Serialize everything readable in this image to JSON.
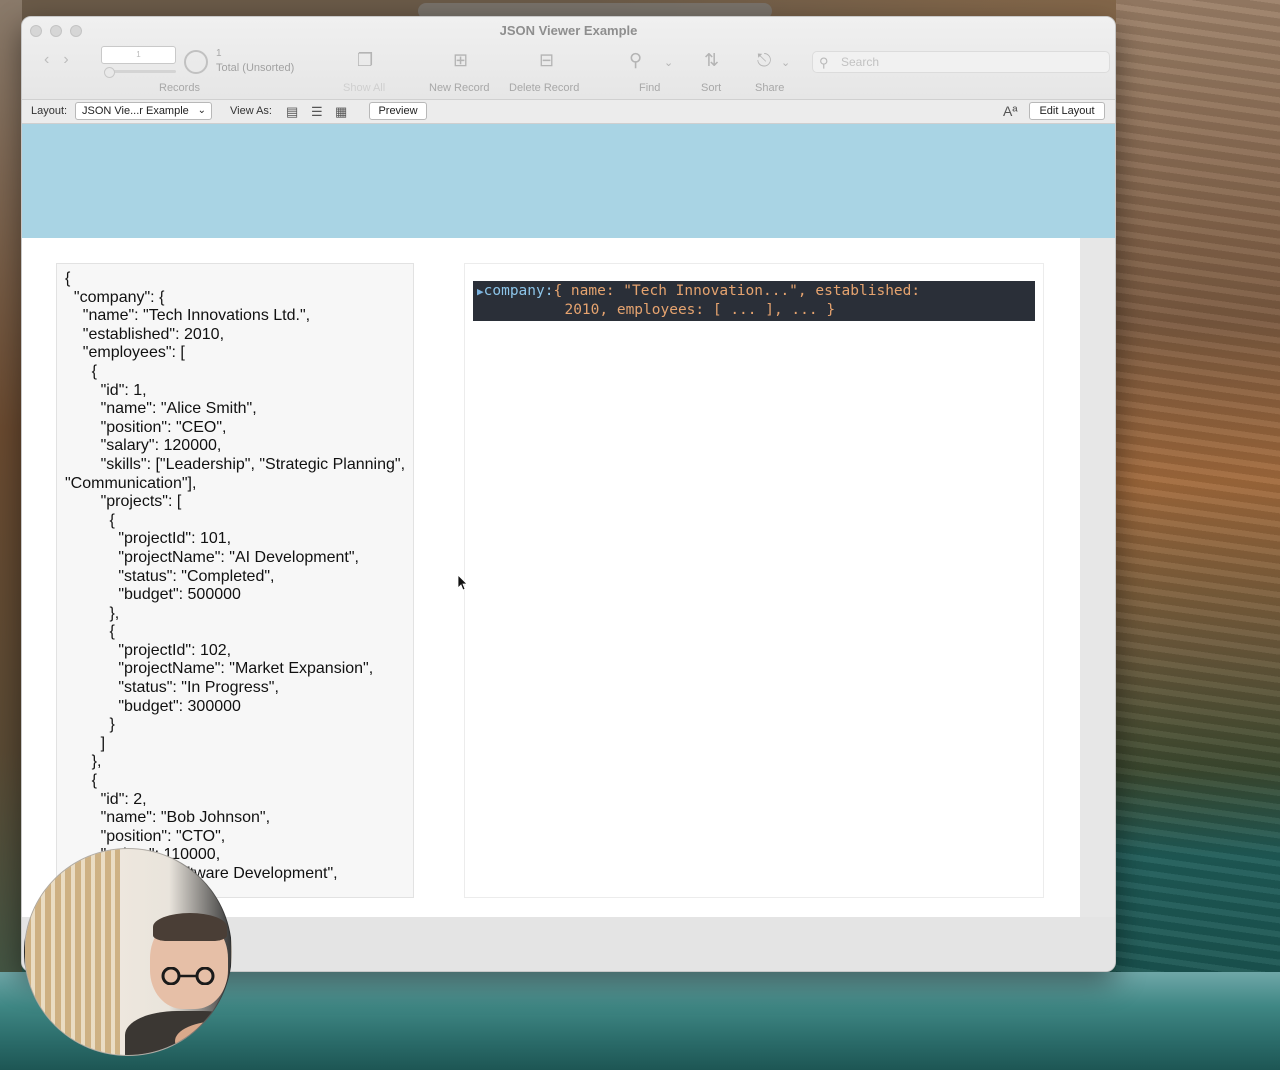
{
  "window": {
    "title": "JSON Viewer Example"
  },
  "toolbar": {
    "record_field": "1",
    "record_count": "1",
    "record_total": "Total (Unsorted)",
    "records_label": "Records",
    "show_all_label": "Show All",
    "new_record_label": "New Record",
    "delete_record_label": "Delete Record",
    "find_label": "Find",
    "sort_label": "Sort",
    "share_label": "Share",
    "search_placeholder": "Search"
  },
  "layout_bar": {
    "layout_label": "Layout:",
    "layout_value": "JSON Vie...r Example",
    "view_as_label": "View As:",
    "preview_label": "Preview",
    "font_icon": "Aª",
    "edit_layout_label": "Edit Layout"
  },
  "json_field": {
    "text": "{\n  \"company\": {\n    \"name\": \"Tech Innovations Ltd.\",\n    \"established\": 2010,\n    \"employees\": [\n      {\n        \"id\": 1,\n        \"name\": \"Alice Smith\",\n        \"position\": \"CEO\",\n        \"salary\": 120000,\n        \"skills\": [\"Leadership\", \"Strategic Planning\", \"Communication\"],\n        \"projects\": [\n          {\n            \"projectId\": 101,\n            \"projectName\": \"AI Development\",\n            \"status\": \"Completed\",\n            \"budget\": 500000\n          },\n          {\n            \"projectId\": 102,\n            \"projectName\": \"Market Expansion\",\n            \"status\": \"In Progress\",\n            \"budget\": 300000\n          }\n        ]\n      },\n      {\n        \"id\": 2,\n        \"name\": \"Bob Johnson\",\n        \"position\": \"CTO\",\n        \"salary\": 110000,\n        \"skills\": [\"Software Development\",\n \"Cybersecurity\"]"
  },
  "json_viewer": {
    "key": "company:",
    "line1": "{ name: \"Tech Innovation...\", established:",
    "line2": "  2010, employees: [ ... ], ... }"
  }
}
